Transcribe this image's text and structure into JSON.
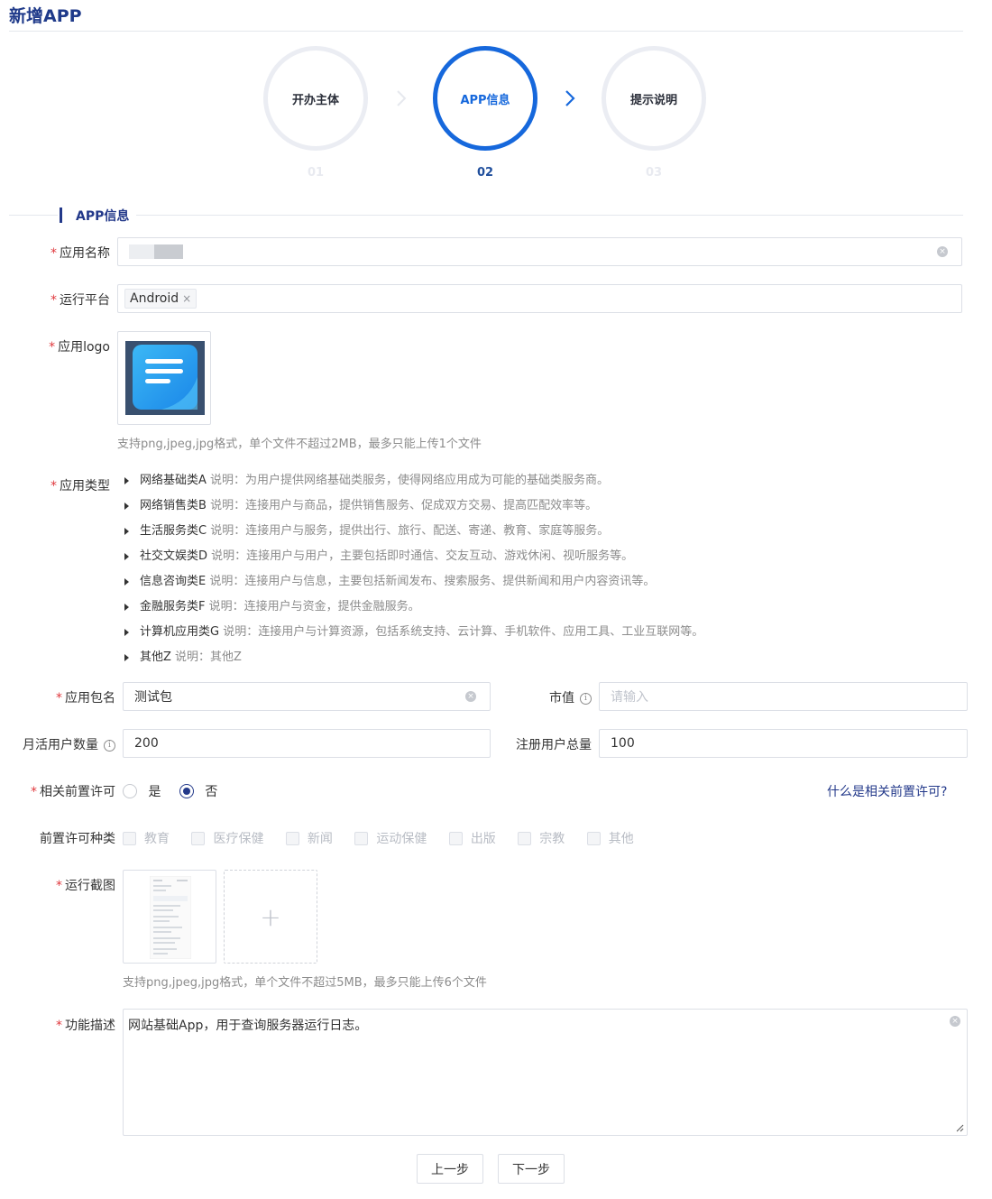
{
  "page": {
    "title": "新增APP"
  },
  "steps": [
    {
      "label": "开办主体",
      "num": "01"
    },
    {
      "label": "APP信息",
      "num": "02"
    },
    {
      "label": "提示说明",
      "num": "03"
    }
  ],
  "section": {
    "title": "APP信息"
  },
  "fields": {
    "app_name": {
      "label": "应用名称",
      "value": ""
    },
    "platform": {
      "label": "运行平台",
      "tag": "Android",
      "tag_close": "×"
    },
    "logo": {
      "label": "应用logo",
      "hint": "支持png,jpeg,jpg格式，单个文件不超过2MB，最多只能上传1个文件"
    },
    "app_type": {
      "label": "应用类型",
      "items": [
        {
          "name": "网络基础类A",
          "desc": "说明：为用户提供网络基础类服务，使得网络应用成为可能的基础类服务商。"
        },
        {
          "name": "网络销售类B",
          "desc": "说明：连接用户与商品，提供销售服务、促成双方交易、提高匹配效率等。"
        },
        {
          "name": "生活服务类C",
          "desc": "说明：连接用户与服务，提供出行、旅行、配送、寄递、教育、家庭等服务。"
        },
        {
          "name": "社交文娱类D",
          "desc": "说明：连接用户与用户，主要包括即时通信、交友互动、游戏休闲、视听服务等。"
        },
        {
          "name": "信息咨询类E",
          "desc": "说明：连接用户与信息，主要包括新闻发布、搜索服务、提供新闻和用户内容资讯等。"
        },
        {
          "name": "金融服务类F",
          "desc": "说明：连接用户与资金，提供金融服务。"
        },
        {
          "name": "计算机应用类G",
          "desc": "说明：连接用户与计算资源，包括系统支持、云计算、手机软件、应用工具、工业互联网等。"
        },
        {
          "name": "其他Z",
          "desc": "说明：其他Z"
        }
      ]
    },
    "package": {
      "label": "应用包名",
      "value": "测试包"
    },
    "market_value": {
      "label": "市值",
      "placeholder": "请输入"
    },
    "mau": {
      "label": "月活用户数量",
      "value": "200"
    },
    "registered": {
      "label": "注册用户总量",
      "value": "100"
    },
    "permit": {
      "label": "相关前置许可",
      "options": [
        "是",
        "否"
      ],
      "selected": "否",
      "help_link": "什么是相关前置许可?"
    },
    "permit_types": {
      "label": "前置许可种类",
      "options": [
        "教育",
        "医疗保健",
        "新闻",
        "运动保健",
        "出版",
        "宗教",
        "其他"
      ]
    },
    "screenshots": {
      "label": "运行截图",
      "add": "+",
      "hint": "支持png,jpeg,jpg格式，单个文件不超过5MB，最多只能上传6个文件"
    },
    "description": {
      "label": "功能描述",
      "value": "网站基础App，用于查询服务器运行日志。"
    }
  },
  "buttons": {
    "prev": "上一步",
    "next": "下一步"
  },
  "colors": {
    "primary": "#1668dc",
    "navy": "#23398a",
    "required": "#e0393e"
  }
}
